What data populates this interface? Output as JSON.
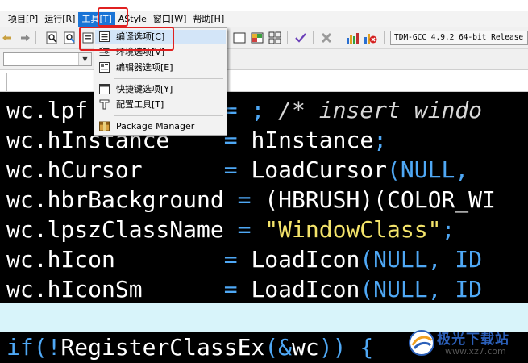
{
  "menubar": {
    "items": [
      {
        "label": "项目[P]"
      },
      {
        "label": "运行[R]"
      },
      {
        "label": "工具[T]"
      },
      {
        "label": "AStyle"
      },
      {
        "label": "窗口[W]"
      },
      {
        "label": "帮助[H]"
      }
    ],
    "selected_index": 2
  },
  "toolbar": {
    "compiler_select": "TDM-GCC 4.9.2 64-bit Release"
  },
  "tools_menu": {
    "items": [
      {
        "label": "编译选项[C]",
        "icon": "compiler-options-icon"
      },
      {
        "label": "环境选项[V]",
        "icon": "environment-options-icon"
      },
      {
        "label": "编辑器选项[E]",
        "icon": "editor-options-icon"
      },
      {
        "label": "快捷键选项[Y]",
        "icon": "shortcut-options-icon"
      },
      {
        "label": "配置工具[T]",
        "icon": "configure-tools-icon"
      },
      {
        "label": "Package Manager",
        "icon": "package-manager-icon"
      }
    ]
  },
  "editor": {
    "lines": [
      {
        "ident": "wc.lpf",
        "op": "=",
        "rest_op": ";",
        "comment": "/* insert windo"
      },
      {
        "ident": "wc.hInstance",
        "op": "=",
        "rest": "hInstance",
        "tail_op": ";"
      },
      {
        "ident": "wc.hCursor",
        "op": "=",
        "rest": "LoadCursor",
        "tail_op": "(NULL,"
      },
      {
        "ident": "wc.hbrBackground",
        "op": "=",
        "rest": "(HBRUSH)(COLOR_WI"
      },
      {
        "ident": "wc.lpszClassName",
        "op": "=",
        "str": "\"WindowClass\"",
        "tail_op": ";"
      },
      {
        "ident": "wc.hIcon",
        "op": "=",
        "rest": "LoadIcon",
        "tail_op": "(NULL, ID"
      },
      {
        "ident": "wc.hIconSm",
        "op": "=",
        "rest": "LoadIcon",
        "tail_op": "(NULL, ID"
      }
    ],
    "last_line": {
      "keyword": "if",
      "op1": "(!",
      "rest": "RegisterClassEx",
      "op2": "(&",
      "arg": "wc",
      "op3": ")) {"
    }
  },
  "watermark": {
    "name": "极光下载站",
    "url": "www.xz7.com"
  }
}
